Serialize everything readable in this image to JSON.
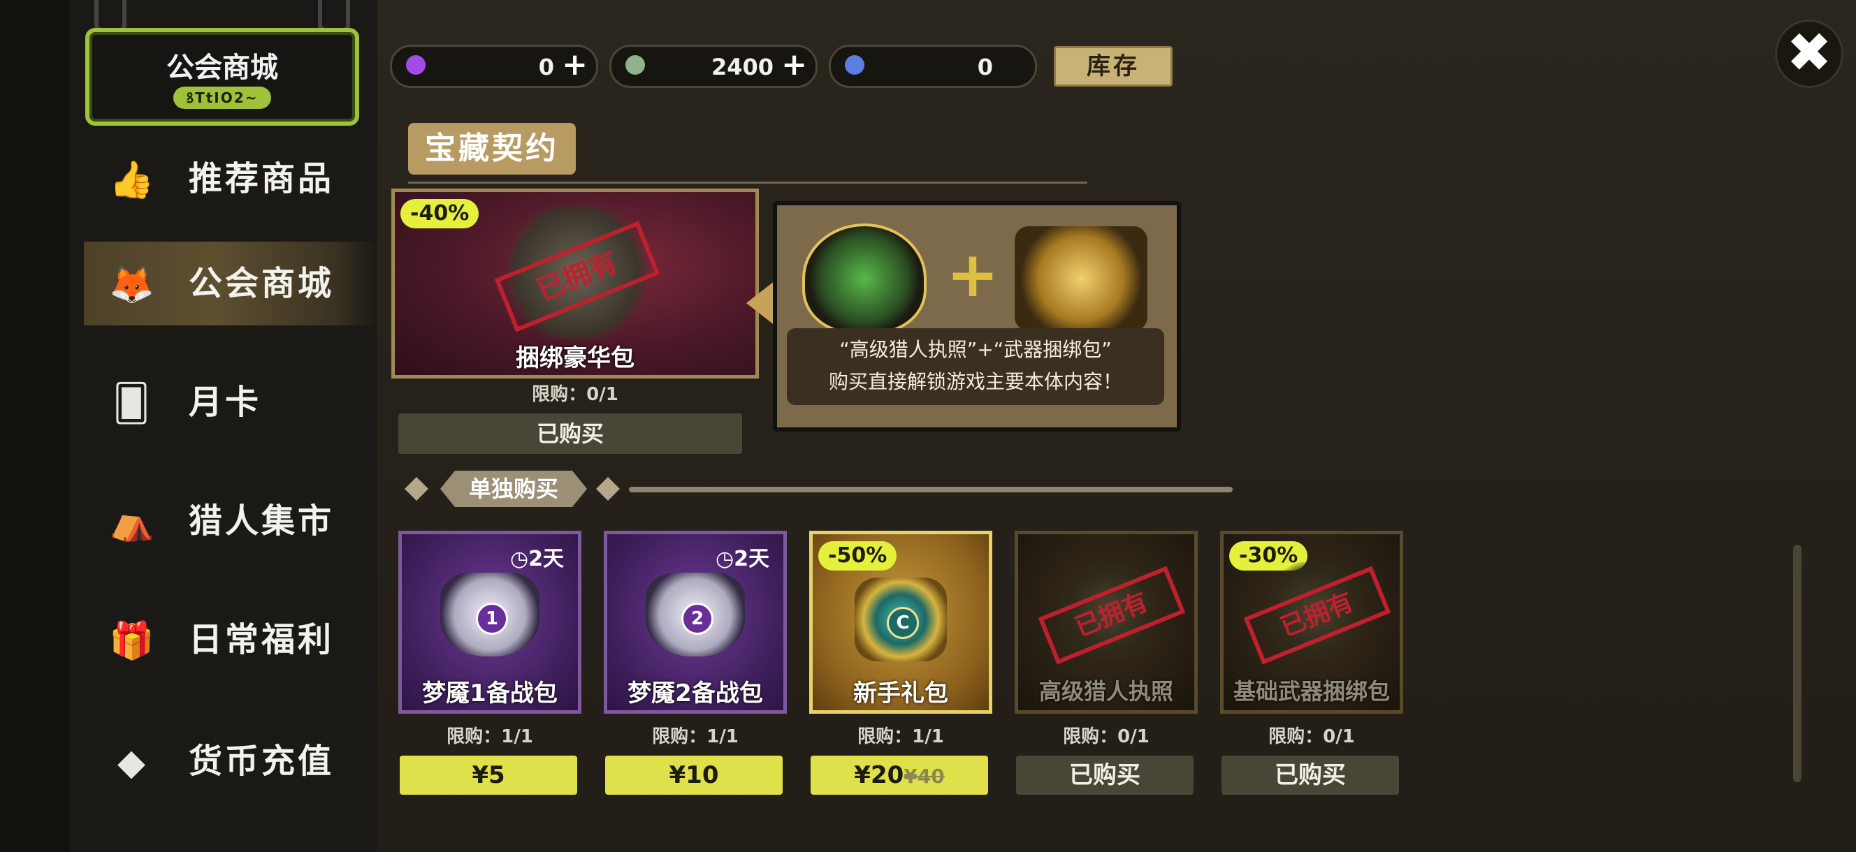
{
  "sign": {
    "title": "公会商城",
    "code": "ꝸTtIO2~"
  },
  "nav": [
    {
      "label": "推荐商品",
      "icon": "thumbs-up-icon",
      "glyph": "👍"
    },
    {
      "label": "公会商城",
      "icon": "fox-head-icon",
      "glyph": "🦊"
    },
    {
      "label": "月卡",
      "icon": "card-icon",
      "glyph": "🂠"
    },
    {
      "label": "猎人集市",
      "icon": "market-stall-icon",
      "glyph": "⛺"
    },
    {
      "label": "日常福利",
      "icon": "gift-box-icon",
      "glyph": "🎁"
    },
    {
      "label": "货币充值",
      "icon": "coin-diamond-icon",
      "glyph": "◆"
    }
  ],
  "currency": [
    {
      "icon": "purple-gem-icon",
      "color": "#a24ce8",
      "value": "0",
      "plus": "+"
    },
    {
      "icon": "guild-coin-icon",
      "color": "#8fb38a",
      "value": "2400",
      "plus": "+"
    },
    {
      "icon": "blue-crystal-icon",
      "color": "#5a7fe0",
      "value": "0"
    }
  ],
  "inventory_label": "库存",
  "close_glyph": "✖",
  "treasure": {
    "title": "宝藏契约",
    "bundle": {
      "discount": "-40%",
      "stamp": "已拥有",
      "name": "捆绑豪华包",
      "limit": "限购：0/1",
      "button": "已购买"
    },
    "info": {
      "line1": "“高级猎人执照”+“武器捆绑包”",
      "line2": "购买直接解锁游戏主要本体内容！",
      "plus": "+"
    }
  },
  "single_label": "单独购买",
  "items": [
    {
      "name": "梦魇1备战包",
      "timer": "◷2天",
      "badge": "1",
      "limit": "限购：1/1",
      "price": "¥5",
      "style": "purple"
    },
    {
      "name": "梦魇2备战包",
      "timer": "◷2天",
      "badge": "2",
      "limit": "限购：1/1",
      "price": "¥10",
      "style": "purple"
    },
    {
      "name": "新手礼包",
      "discount": "-50%",
      "badge": "C",
      "limit": "限购：1/1",
      "price": "¥20",
      "old_price": "¥40",
      "style": "gold"
    },
    {
      "name": "高级猎人执照",
      "stamp": "已拥有",
      "limit": "限购：0/1",
      "button": "已购买",
      "style": "dark"
    },
    {
      "name": "基础武器捆绑包",
      "discount": "-30%",
      "stamp": "已拥有",
      "limit": "限购：0/1",
      "button": "已购买",
      "style": "dark"
    }
  ]
}
